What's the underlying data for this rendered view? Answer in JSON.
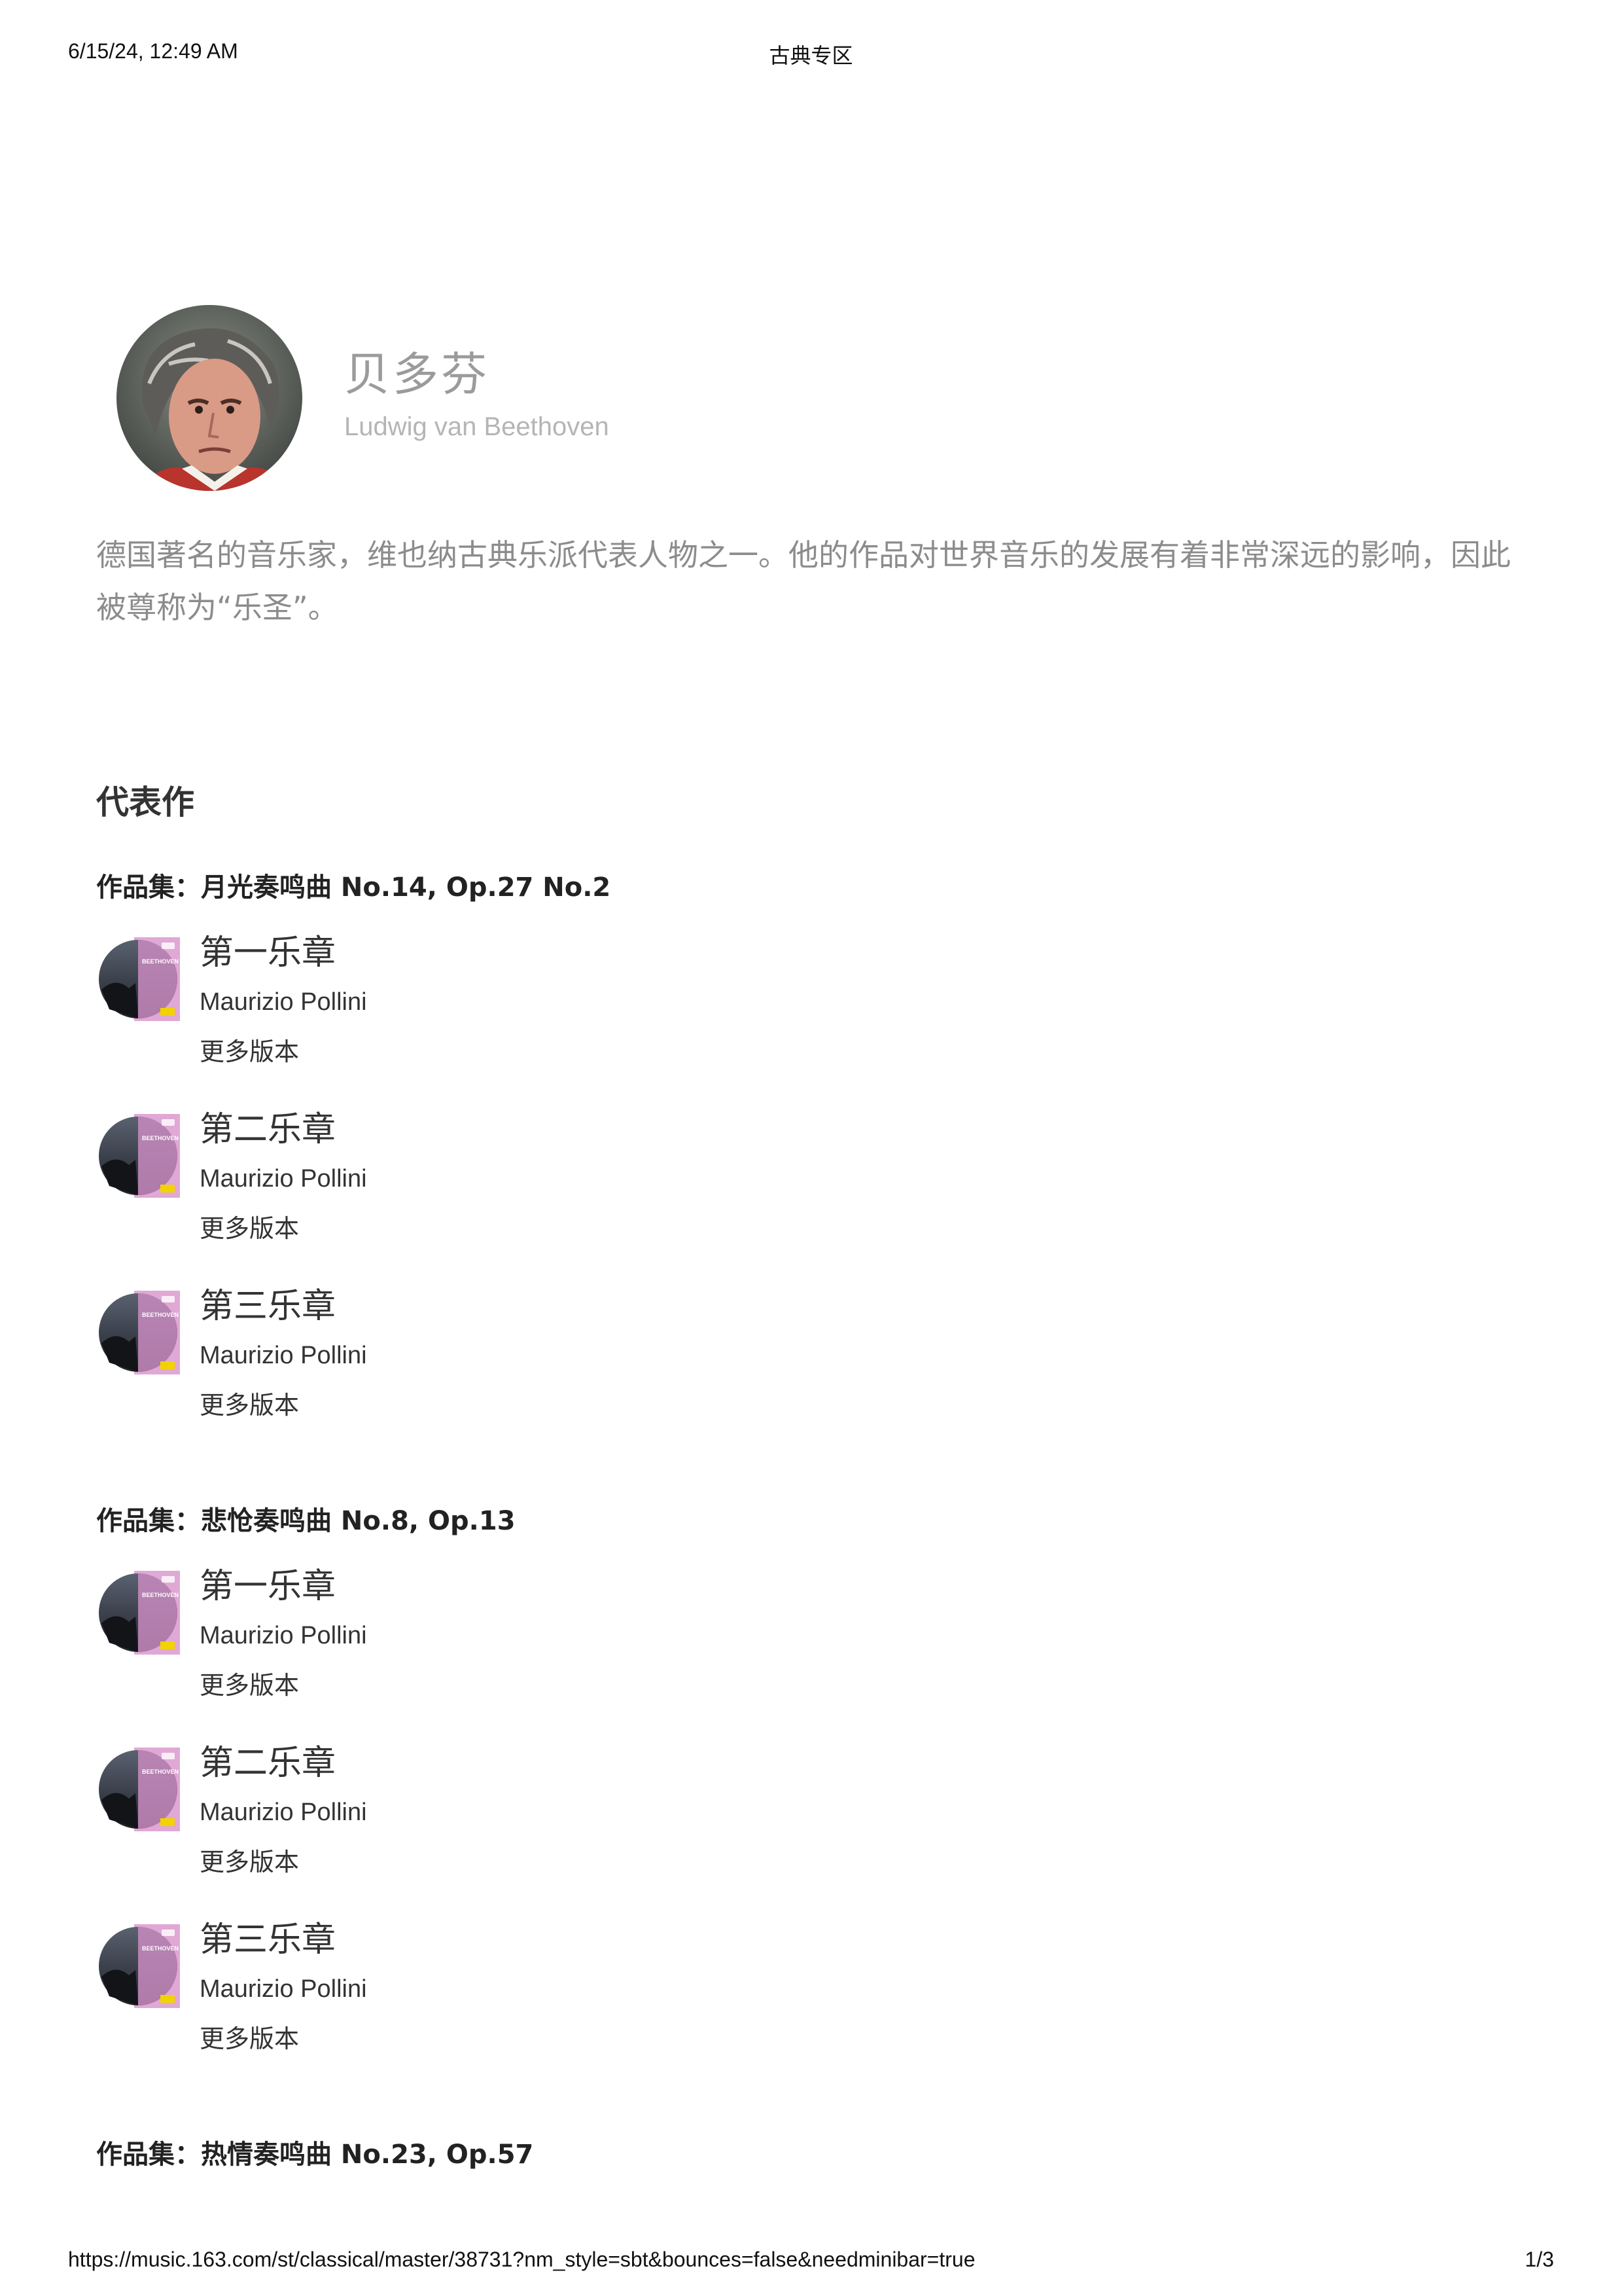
{
  "print": {
    "datetime": "6/15/24, 12:49 AM",
    "page_title": "古典专区",
    "url": "https://music.163.com/st/classical/master/38731?nm_style=sbt&bounces=false&needminibar=true",
    "page_number": "1/3"
  },
  "artist": {
    "name": "贝多芬",
    "name_en": "Ludwig van Beethoven",
    "bio": "德国著名的音乐家，维也纳古典乐派代表人物之一。他的作品对世界音乐的发展有着非常深远的影响，因此被尊称为“乐圣”。"
  },
  "section_title": "代表作",
  "collections": [
    {
      "title": "作品集：月光奏鸣曲 No.14, Op.27 No.2",
      "tracks": [
        {
          "title": "第一乐章",
          "artist": "Maurizio Pollini",
          "more": "更多版本"
        },
        {
          "title": "第二乐章",
          "artist": "Maurizio Pollini",
          "more": "更多版本"
        },
        {
          "title": "第三乐章",
          "artist": "Maurizio Pollini",
          "more": "更多版本"
        }
      ]
    },
    {
      "title": "作品集：悲怆奏鸣曲 No.8, Op.13",
      "tracks": [
        {
          "title": "第一乐章",
          "artist": "Maurizio Pollini",
          "more": "更多版本"
        },
        {
          "title": "第二乐章",
          "artist": "Maurizio Pollini",
          "more": "更多版本"
        },
        {
          "title": "第三乐章",
          "artist": "Maurizio Pollini",
          "more": "更多版本"
        }
      ]
    },
    {
      "title": "作品集：热情奏鸣曲 No.23, Op.57",
      "tracks": []
    }
  ],
  "cover_text": "BEETHOVEN"
}
